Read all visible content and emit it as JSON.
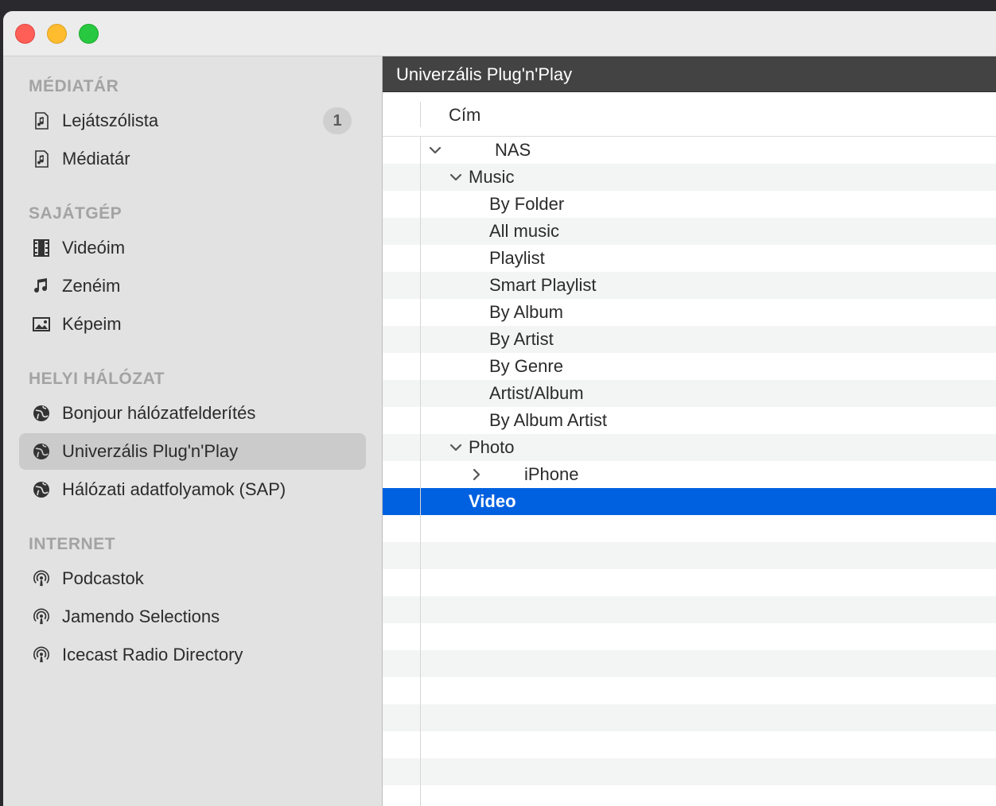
{
  "window": {
    "traffic_lights": [
      "close",
      "minimize",
      "zoom"
    ]
  },
  "sidebar": {
    "sections": [
      {
        "title": "MÉDIATÁR",
        "items": [
          {
            "label": "Lejátszólista",
            "icon": "playlist-icon",
            "badge": "1"
          },
          {
            "label": "Médiatár",
            "icon": "playlist-icon"
          }
        ]
      },
      {
        "title": "SAJÁTGÉP",
        "items": [
          {
            "label": "Videóim",
            "icon": "film-icon"
          },
          {
            "label": "Zenéim",
            "icon": "music-note-icon"
          },
          {
            "label": "Képeim",
            "icon": "picture-icon"
          }
        ]
      },
      {
        "title": "HELYI HÁLÓZAT",
        "items": [
          {
            "label": "Bonjour hálózatfelderítés",
            "icon": "network-icon"
          },
          {
            "label": "Univerzális Plug'n'Play",
            "icon": "network-icon",
            "selected": true
          },
          {
            "label": "Hálózati adatfolyamok (SAP)",
            "icon": "network-icon"
          }
        ]
      },
      {
        "title": "INTERNET",
        "items": [
          {
            "label": "Podcastok",
            "icon": "podcast-icon"
          },
          {
            "label": "Jamendo Selections",
            "icon": "podcast-icon"
          },
          {
            "label": "Icecast Radio Directory",
            "icon": "podcast-icon"
          }
        ]
      }
    ]
  },
  "main": {
    "title": "Univerzális Plug'n'Play",
    "column_title": "Cím",
    "tree": [
      {
        "label": "NAS",
        "disclosure": "expanded"
      },
      {
        "label": "Music",
        "disclosure": "expanded"
      },
      {
        "label": "By Folder"
      },
      {
        "label": "All music"
      },
      {
        "label": "Playlist"
      },
      {
        "label": "Smart Playlist"
      },
      {
        "label": "By Album"
      },
      {
        "label": "By Artist"
      },
      {
        "label": "By Genre"
      },
      {
        "label": "Artist/Album"
      },
      {
        "label": "By Album Artist"
      },
      {
        "label": "Photo",
        "disclosure": "expanded"
      },
      {
        "label": "iPhone",
        "disclosure": "collapsed"
      },
      {
        "label": "Video",
        "selected": true
      }
    ]
  },
  "colors": {
    "selection": "#0061e0",
    "header_bg": "#434343",
    "sidebar_bg": "#e2e2e2"
  }
}
